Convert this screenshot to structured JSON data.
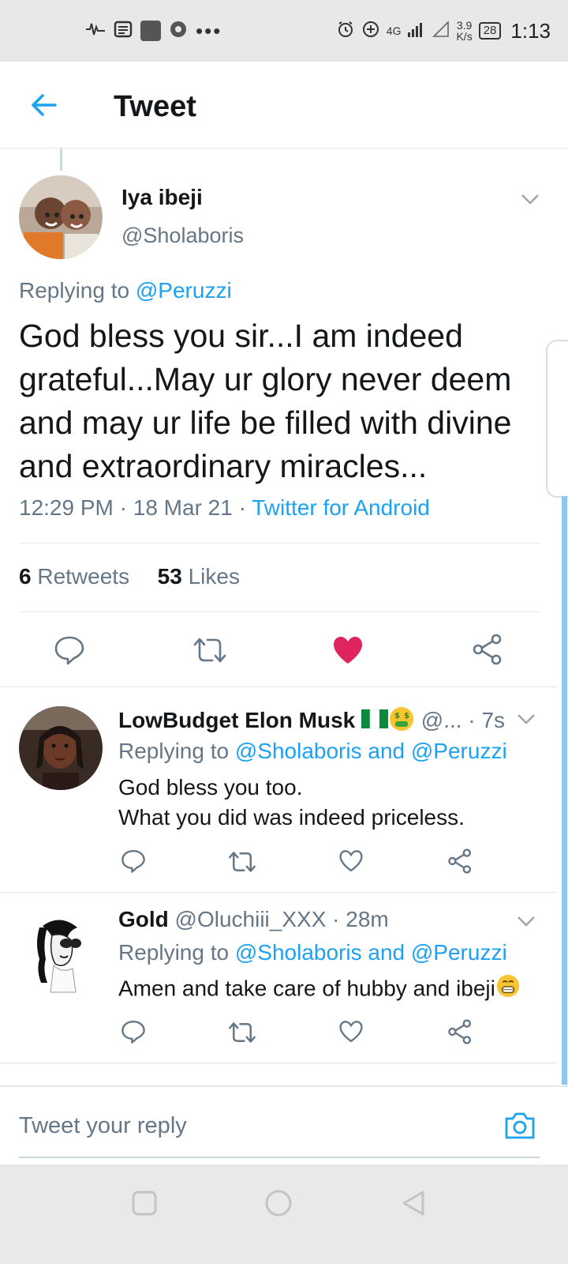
{
  "status_bar": {
    "time": "1:13",
    "network_speed": "3.9",
    "network_unit": "K/s",
    "battery": "28",
    "signal_label": "4G",
    "overflow_dots": "•••"
  },
  "header": {
    "title": "Tweet"
  },
  "main_tweet": {
    "name": "Iya ibeji",
    "handle": "@Sholaboris",
    "replying_prefix": "Replying to ",
    "replying_to": "@Peruzzi",
    "text": "God bless you sir...I am indeed grateful...May ur glory never deem and may ur life be filled with divine and extraordinary miracles...",
    "time": "12:29 PM",
    "date": "18 Mar 21",
    "separator": " · ",
    "source": "Twitter for Android",
    "retweets_count": "6",
    "retweets_label": "Retweets",
    "likes_count": "53",
    "likes_label": "Likes",
    "liked": true
  },
  "replies": [
    {
      "name": "LowBudget Elon Musk",
      "handle": "@...",
      "time": "7s",
      "replying_prefix": "Replying to ",
      "replying_to": "@Sholaboris and @Peruzzi",
      "text_line1": "God bless you too.",
      "text_line2": "What you did was indeed priceless."
    },
    {
      "name": "Gold",
      "handle": "@Oluchiii_XXX",
      "time": "28m",
      "replying_prefix": "Replying to ",
      "replying_to": "@Sholaboris and @Peruzzi",
      "text_line1": "Amen and take care of hubby and ibeji"
    }
  ],
  "compose": {
    "placeholder": "Tweet your reply"
  },
  "colors": {
    "accent": "#1da1f2",
    "like": "#e0245e",
    "secondary_text": "#657786",
    "primary_text": "#14171a"
  },
  "icons": {
    "back": "arrow-left-icon",
    "reply": "reply-bubble-icon",
    "retweet": "retweet-icon",
    "like": "heart-icon",
    "share": "share-icon",
    "camera": "camera-icon",
    "chevron": "chevron-down-icon"
  }
}
